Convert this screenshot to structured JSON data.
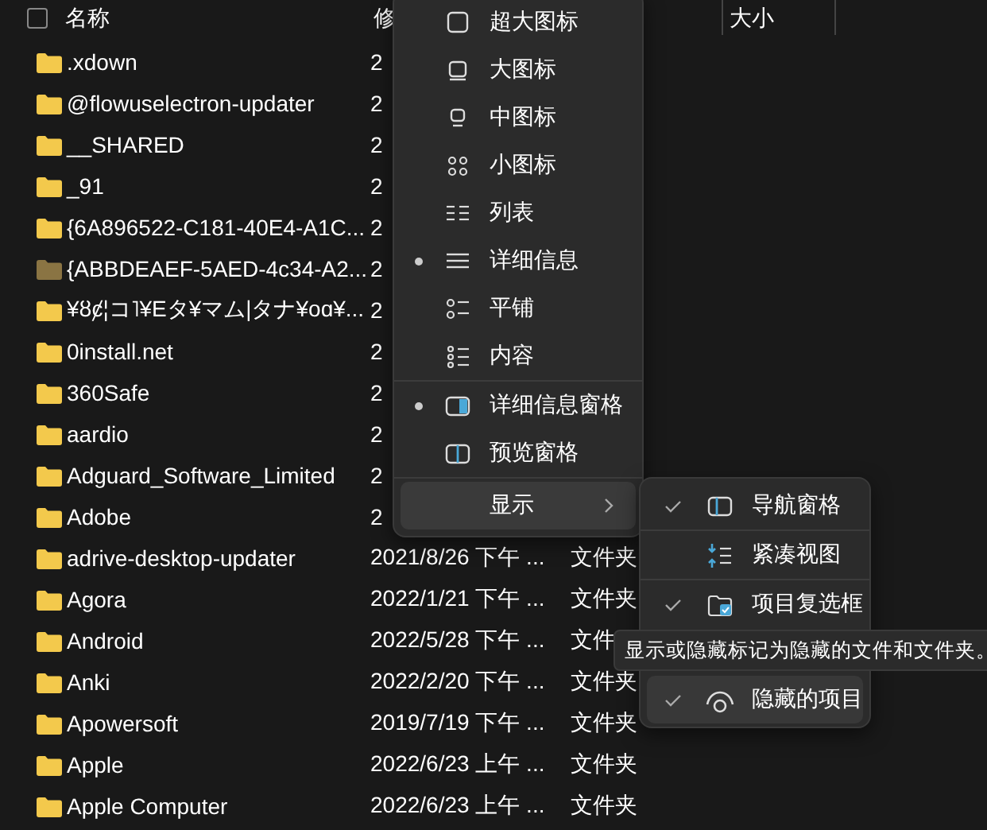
{
  "table": {
    "select_all": {
      "checked": false
    },
    "columns": [
      {
        "label": "名称"
      },
      {
        "label": "修"
      },
      {
        "label": "大小"
      }
    ],
    "rows": [
      {
        "name": ".xdown",
        "date": "2",
        "hidden": false
      },
      {
        "name": "@flowuselectron-updater",
        "date": "2",
        "hidden": false
      },
      {
        "name": "__SHARED",
        "date": "2",
        "hidden": false
      },
      {
        "name": "_91",
        "date": "2",
        "hidden": false
      },
      {
        "name": "{6A896522-C181-40E4-A1C...",
        "date": "2",
        "hidden": false
      },
      {
        "name": "{ABBDEAEF-5AED-4c34-A2...",
        "date": "2",
        "hidden": true
      },
      {
        "name": "¥ȣȼ¦コ˥¥Eタ¥マム|タナ¥oɑ¥...",
        "date": "2",
        "hidden": false
      },
      {
        "name": "0install.net",
        "date": "2",
        "hidden": false
      },
      {
        "name": "360Safe",
        "date": "2",
        "hidden": false
      },
      {
        "name": "aardio",
        "date": "2",
        "hidden": false
      },
      {
        "name": "Adguard_Software_Limited",
        "date": "2",
        "hidden": false
      },
      {
        "name": "Adobe",
        "date": "2",
        "hidden": false
      },
      {
        "name": "adrive-desktop-updater",
        "date": "2021/8/26 下午 ...",
        "type": "文件夹",
        "hidden": false
      },
      {
        "name": "Agora",
        "date": "2022/1/21 下午 ...",
        "type": "文件夹",
        "hidden": false
      },
      {
        "name": "Android",
        "date": "2022/5/28 下午 ...",
        "type": "文件",
        "hidden": false
      },
      {
        "name": "Anki",
        "date": "2022/2/20 下午 ...",
        "type": "文件夹",
        "hidden": false
      },
      {
        "name": "Apowersoft",
        "date": "2019/7/19 下午 ...",
        "type": "文件夹",
        "hidden": false
      },
      {
        "name": "Apple",
        "date": "2022/6/23 上午 ...",
        "type": "文件夹",
        "hidden": false
      },
      {
        "name": "Apple Computer",
        "date": "2022/6/23 上午 ...",
        "type": "文件夹",
        "hidden": false
      }
    ]
  },
  "view_menu": {
    "items": [
      {
        "kind": "item",
        "label": "超大图标",
        "selected": false
      },
      {
        "kind": "item",
        "label": "大图标",
        "selected": false
      },
      {
        "kind": "item",
        "label": "中图标",
        "selected": false
      },
      {
        "kind": "item",
        "label": "小图标",
        "selected": false
      },
      {
        "kind": "item",
        "label": "列表",
        "selected": false
      },
      {
        "kind": "item",
        "label": "详细信息",
        "selected": true
      },
      {
        "kind": "item",
        "label": "平铺",
        "selected": false
      },
      {
        "kind": "item",
        "label": "内容",
        "selected": false
      },
      {
        "kind": "separator"
      },
      {
        "kind": "item",
        "label": "详细信息窗格",
        "selected": true
      },
      {
        "kind": "item",
        "label": "预览窗格",
        "selected": false
      },
      {
        "kind": "separator"
      },
      {
        "kind": "submenu",
        "label": "显示"
      }
    ]
  },
  "show_submenu": {
    "items": [
      {
        "kind": "item",
        "label": "导航窗格",
        "checked": true,
        "hovered": false
      },
      {
        "kind": "separator"
      },
      {
        "kind": "item",
        "label": "紧凑视图",
        "checked": false,
        "hovered": false
      },
      {
        "kind": "separator"
      },
      {
        "kind": "item",
        "label": "项目复选框",
        "checked": true,
        "hovered": false
      },
      {
        "kind": "covered"
      },
      {
        "kind": "item",
        "label": "隐藏的项目",
        "checked": true,
        "hovered": true
      }
    ]
  },
  "tooltip": {
    "text": "显示或隐藏标记为隐藏的文件和文件夹。"
  }
}
